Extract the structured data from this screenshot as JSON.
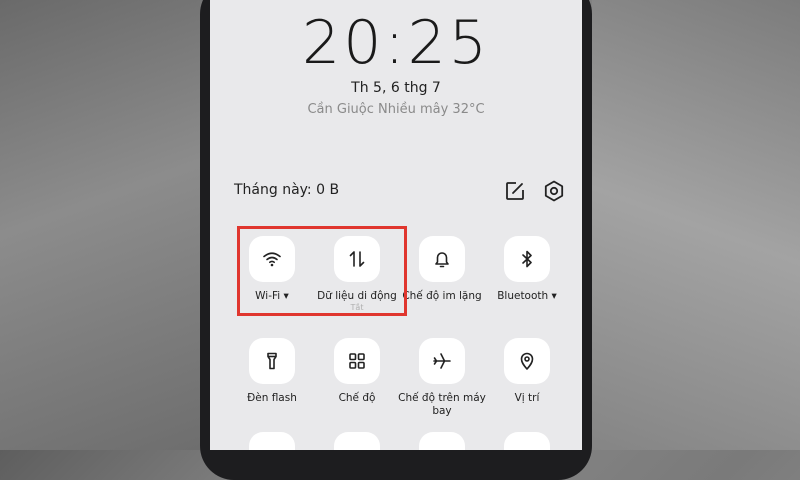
{
  "lockscreen": {
    "time": "20:25",
    "date": "Th 5, 6 thg 7",
    "weather": "Cần Giuộc Nhiều mây 32°C"
  },
  "panel": {
    "usage": "Tháng này: 0 B"
  },
  "tiles": [
    {
      "label": "Wi-Fi ▾",
      "icon": "wifi-icon"
    },
    {
      "label": "Dữ liệu di động",
      "sub": "Tắt",
      "icon": "mobile-data-icon"
    },
    {
      "label": "Chế độ im lặng",
      "icon": "bell-icon"
    },
    {
      "label": "Bluetooth ▾",
      "icon": "bluetooth-icon"
    },
    {
      "label": "Đèn flash",
      "icon": "flashlight-icon"
    },
    {
      "label": "Chế độ",
      "icon": "grid-icon"
    },
    {
      "label": "Chế độ trên máy bay",
      "icon": "airplane-icon"
    },
    {
      "label": "Vị trí",
      "icon": "location-icon"
    }
  ],
  "colors": {
    "highlight": "#e0362e",
    "screen_bg": "#e9e9eb",
    "tile_bg": "#ffffff"
  }
}
